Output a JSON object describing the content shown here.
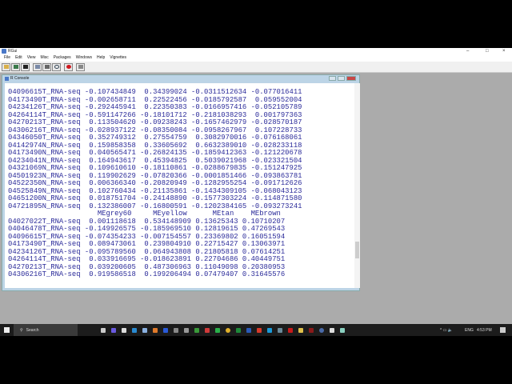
{
  "window": {
    "title": "RGui"
  },
  "menu": [
    "File",
    "Edit",
    "View",
    "Misc",
    "Packages",
    "Windows",
    "Help",
    "Vignettes"
  ],
  "toolbar": [
    "open-script",
    "load-workspace",
    "save-workspace",
    "copy",
    "paste",
    "copy-paste",
    "stop",
    "print"
  ],
  "console": {
    "title": "R Console",
    "lines": [
      "04096615T_RNA-seq -0.107434849  0.34399024 -0.0311512634 -0.077016411",
      "04173490T_RNA-seq -0.002658711  0.22522456 -0.0185792587  0.059552004",
      "04234126T_RNA-seq -0.292445941  0.22350383 -0.0166957416 -0.052105789",
      "04264114T_RNA-seq -0.591147266 -0.18101712 -0.2181038293  0.001797363",
      "04270213T_RNA-seq  0.113504620 -0.09238243 -0.1657462979 -0.028570187",
      "04306216T_RNA-seq -0.028937122 -0.08350084 -0.0958267967  0.107228733",
      "04346050T_RNA-seq  0.352749312  0.27554759  0.3082970016 -0.076168061",
      "04142974N_RNA-seq  0.159858358  0.33605692  0.6632389010 -0.028233118",
      "04173490N_RNA-seq  0.040565471 -0.26824135 -0.1859412363 -0.121220678",
      "04234041N_RNA-seq  0.164943617  0.45394825  0.5039021968 -0.023321504",
      "04321069N_RNA-seq  0.109610610 -0.18110861 -0.0288679835 -0.151247925",
      "04501923N_RNA-seq  0.119902629 -0.07820366 -0.0001851466 -0.093863781",
      "04522350N_RNA-seq  0.006366340 -0.20820949 -0.1282955254 -0.091712626",
      "04525849N_RNA-seq  0.102760434 -0.21135861 -0.1434309105 -0.068043123",
      "04651200N_RNA-seq  0.018751704 -0.24148890 -0.1577303224 -0.114871580",
      "04721895N_RNA-seq  0.132386007 -0.16800591 -0.1202384165 -0.093273241",
      "                     MEgrey60     MEyellow      MEtan    MEbrown",
      "04027022T_RNA-seq  0.001118618  0.534148909 0.13625343 0.10710207",
      "04046478T_RNA-seq -0.149926575 -0.185969510 0.12819615 0.47269543",
      "04096615T_RNA-seq -0.074354233 -0.007154557 0.23369802 0.16051594",
      "04173490T_RNA-seq  0.089473061  0.239804910 0.22715427 0.13063971",
      "04234126T_RNA-seq -0.095789560  0.064943808 0.21805818 0.07614251",
      "04264114T_RNA-seq  0.033916695 -0.018623891 0.22704686 0.40449751",
      "04270213T_RNA-seq  0.039200605  0.487306963 0.11049098 0.20380953",
      "04306216T_RNA-seq  0.919586518  0.199206494 0.07479407 0.31645576"
    ]
  },
  "taskbar": {
    "search_placeholder": "Search",
    "language": "ENG",
    "time": "4:53 PM"
  },
  "colors": {
    "console_text": "#2b2b9a",
    "mdi_bg": "#ababab"
  }
}
